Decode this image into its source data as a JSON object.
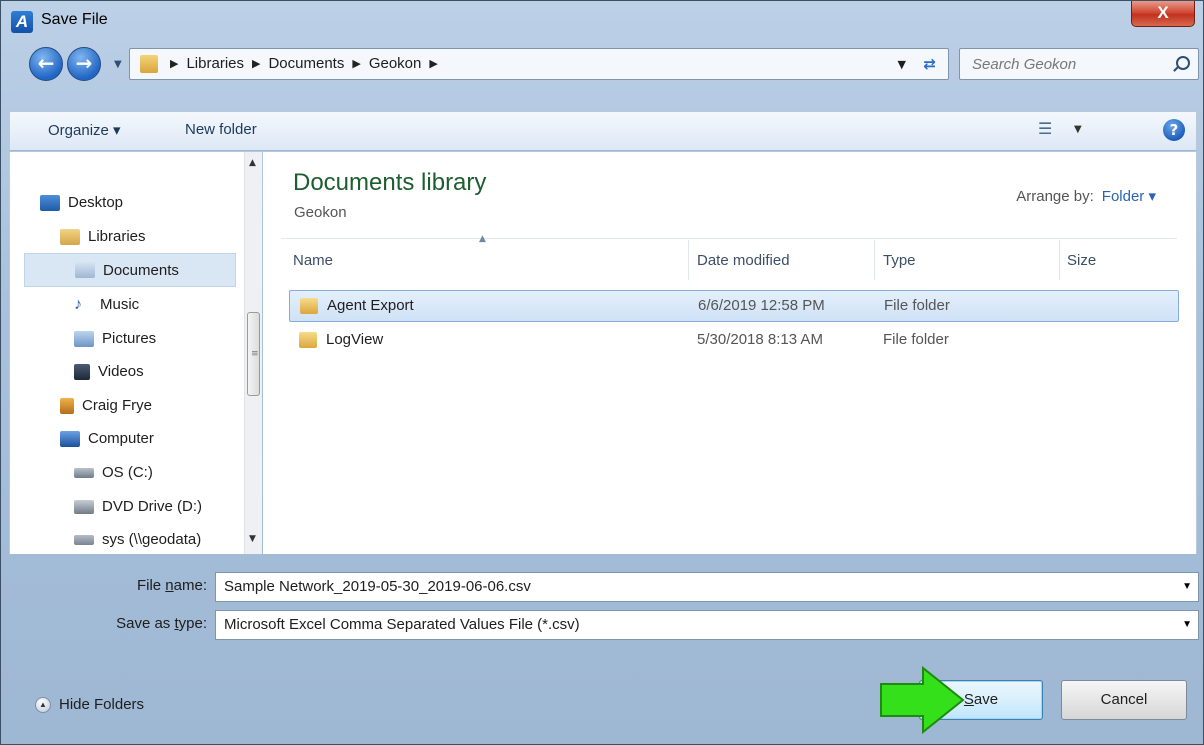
{
  "window": {
    "title": "Save File",
    "app_icon_letter": "A",
    "close_label": "X"
  },
  "address": {
    "crumbs": [
      "Libraries",
      "Documents",
      "Geokon"
    ],
    "search_placeholder": "Search Geokon"
  },
  "toolbar": {
    "organize_label": "Organize ▾",
    "new_folder_label": "New folder",
    "help_label": "?"
  },
  "nav": {
    "items": [
      {
        "label": "Desktop",
        "icon": "desktop-icon"
      },
      {
        "label": "Libraries",
        "icon": "libraries-icon"
      },
      {
        "label": "Documents",
        "icon": "documents-icon",
        "selected": true
      },
      {
        "label": "Music",
        "icon": "music-icon"
      },
      {
        "label": "Pictures",
        "icon": "pictures-icon"
      },
      {
        "label": "Videos",
        "icon": "videos-icon"
      },
      {
        "label": "Craig Frye",
        "icon": "user-icon"
      },
      {
        "label": "Computer",
        "icon": "computer-icon"
      },
      {
        "label": "OS (C:)",
        "icon": "drive-icon"
      },
      {
        "label": "DVD Drive (D:)",
        "icon": "dvd-icon"
      },
      {
        "label": "sys (\\\\geodata)",
        "icon": "network-drive-icon"
      }
    ]
  },
  "content": {
    "library_title": "Documents library",
    "library_subtitle": "Geokon",
    "arrange_label": "Arrange by:",
    "arrange_value": "Folder ▾",
    "columns": [
      "Name",
      "Date modified",
      "Type",
      "Size"
    ],
    "rows": [
      {
        "name": "Agent Export",
        "date": "6/6/2019 12:58 PM",
        "type": "File folder",
        "selected": true
      },
      {
        "name": "LogView",
        "date": "5/30/2018 8:13 AM",
        "type": "File folder"
      }
    ]
  },
  "form": {
    "file_name_label_pre": "File ",
    "file_name_label_u": "n",
    "file_name_label_post": "ame:",
    "file_name_value": "Sample Network_2019-05-30_2019-06-06.csv",
    "save_type_label_pre": "Save as ",
    "save_type_label_u": "t",
    "save_type_label_post": "ype:",
    "save_type_value": "Microsoft Excel Comma Separated Values File (*.csv)",
    "hide_folders_label": "Hide Folders",
    "save_label_u": "S",
    "save_label_rest": "ave",
    "cancel_label": "Cancel"
  },
  "colors": {
    "arrow_green": "#33e01a",
    "library_title": "#1e5d2f",
    "selection": "#cfe2f6"
  }
}
